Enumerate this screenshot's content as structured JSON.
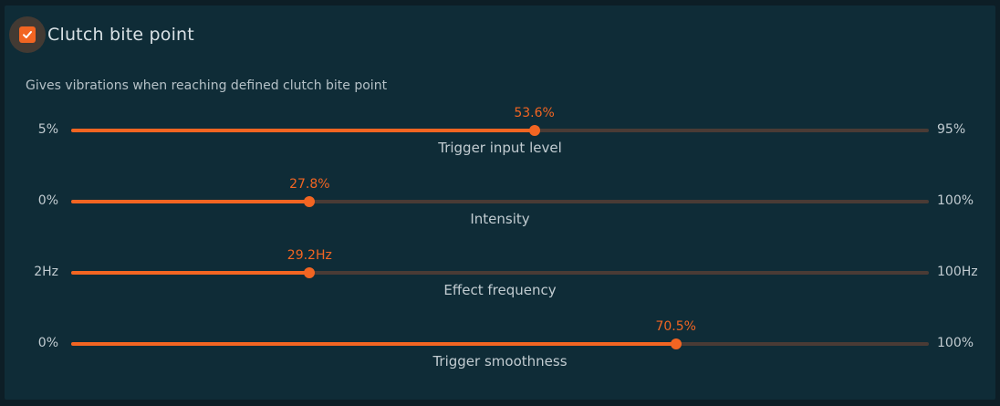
{
  "header": {
    "title": "Clutch bite point",
    "enabled": true
  },
  "description": "Gives vibrations when reaching defined clutch bite point",
  "colors": {
    "accent": "#f26522",
    "panel": "#0f2c37",
    "track": "#4a3b35"
  },
  "sliders": [
    {
      "name": "Trigger input level",
      "min": "5%",
      "max": "95%",
      "value_label": "53.6%",
      "fraction": 0.54
    },
    {
      "name": "Intensity",
      "min": "0%",
      "max": "100%",
      "value_label": "27.8%",
      "fraction": 0.278
    },
    {
      "name": "Effect frequency",
      "min": "2Hz",
      "max": "100Hz",
      "value_label": "29.2Hz",
      "fraction": 0.278
    },
    {
      "name": "Trigger smoothness",
      "min": "0%",
      "max": "100%",
      "value_label": "70.5%",
      "fraction": 0.705
    }
  ]
}
